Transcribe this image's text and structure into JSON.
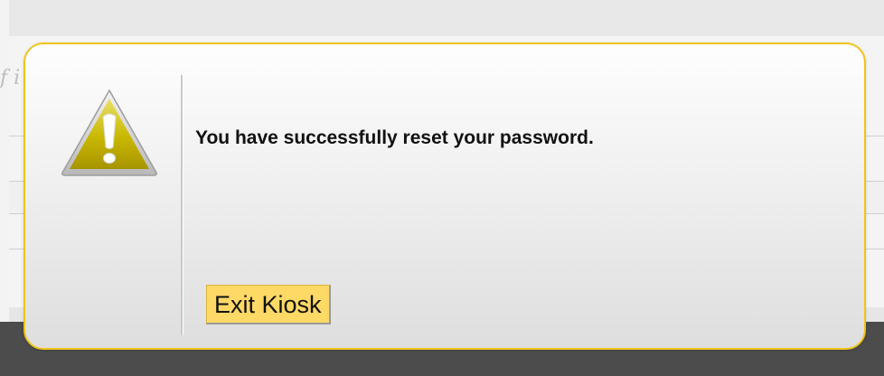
{
  "background": {
    "partial_text": "f i"
  },
  "dialog": {
    "icon": "warning-triangle-icon",
    "message": "You have successfully reset your password.",
    "exit_button_label": "Exit Kiosk",
    "colors": {
      "border": "#f0c419",
      "button": "#ffd966",
      "icon": "#c9b800"
    }
  }
}
